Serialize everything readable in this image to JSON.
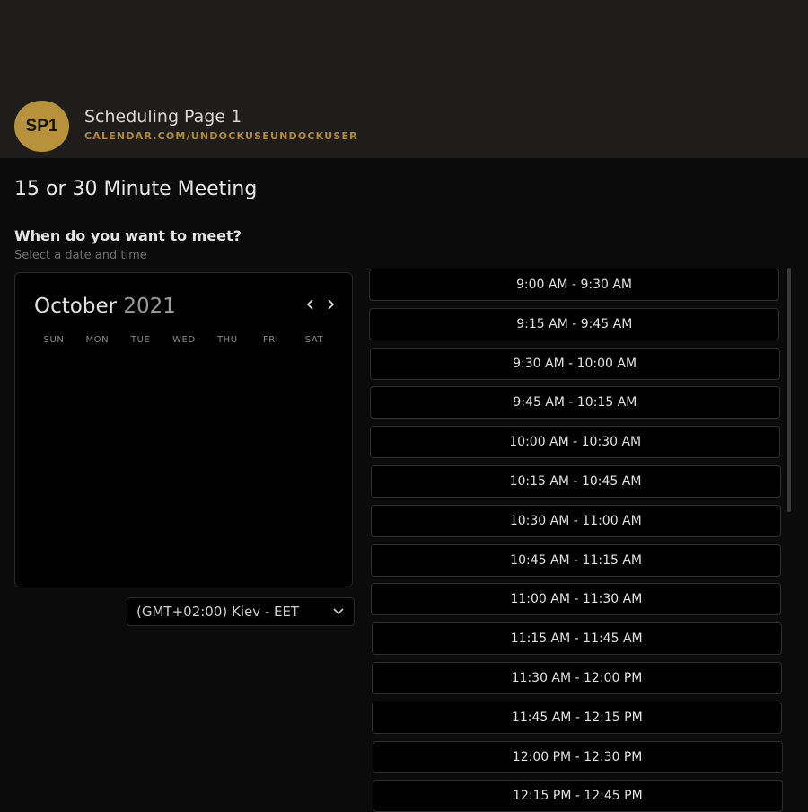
{
  "header": {
    "avatar_initials": "SP1",
    "page_name": "Scheduling Page 1",
    "page_url": "CALENDAR.COM/UNDOCKUSEUNDOCKUSER",
    "accent_color": "#b8923a"
  },
  "main": {
    "event_title": "15 or 30 Minute Meeting",
    "question": "When do you want to meet?",
    "hint": "Select a date and time"
  },
  "calendar": {
    "month": "October",
    "year": "2021",
    "prev_icon": "chevron-left-icon",
    "next_icon": "chevron-right-icon",
    "weekdays": [
      "SUN",
      "MON",
      "TUE",
      "WED",
      "THU",
      "FRI",
      "SAT"
    ]
  },
  "timezone": {
    "selected": "(GMT+02:00) Kiev - EET",
    "icon": "chevron-down-icon"
  },
  "time_slots": [
    "9:00 AM - 9:30 AM",
    "9:15 AM - 9:45 AM",
    "9:30 AM - 10:00 AM",
    "9:45 AM - 10:15 AM",
    "10:00 AM - 10:30 AM",
    "10:15 AM - 10:45 AM",
    "10:30 AM - 11:00 AM",
    "10:45 AM - 11:15 AM",
    "11:00 AM - 11:30 AM",
    "11:15 AM - 11:45 AM",
    "11:30 AM - 12:00 PM",
    "11:45 AM - 12:15 PM",
    "12:00 PM - 12:30 PM",
    "12:15 PM - 12:45 PM"
  ]
}
